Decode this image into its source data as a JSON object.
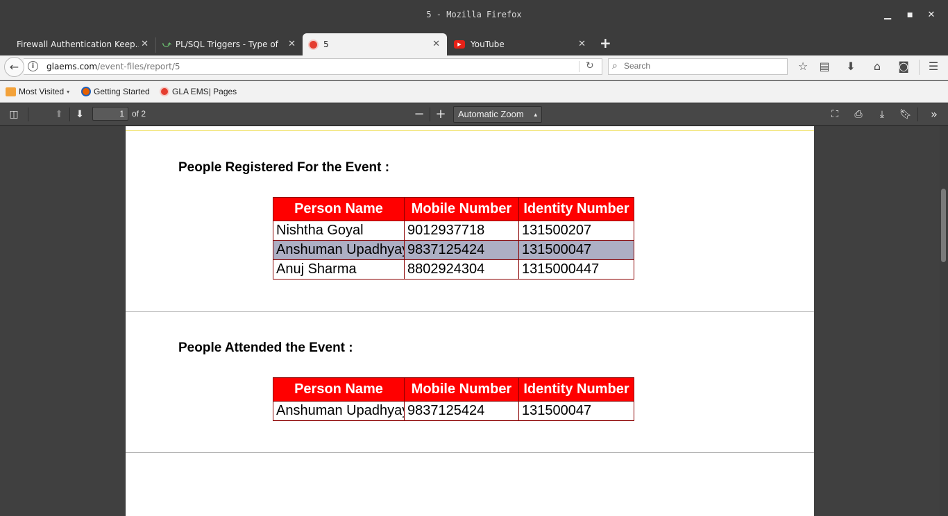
{
  "window": {
    "title": "5 - Mozilla Firefox"
  },
  "tabs": [
    {
      "label": "Firewall Authentication Keep...",
      "icon": "none"
    },
    {
      "label": "PL/SQL Triggers - Type of ...",
      "icon": "tutorials-icon"
    },
    {
      "label": "5",
      "icon": "gla-icon",
      "active": true
    },
    {
      "label": "YouTube",
      "icon": "youtube-icon"
    }
  ],
  "navbar": {
    "url_domain": "glaems.com",
    "url_path": "/event-files/report/5",
    "search_placeholder": "Search"
  },
  "bookmarks": [
    {
      "label": "Most Visited",
      "icon": "folder-icon"
    },
    {
      "label": "Getting Started",
      "icon": "firefox-icon"
    },
    {
      "label": "GLA EMS| Pages",
      "icon": "gla-icon"
    }
  ],
  "pdf_toolbar": {
    "page_number": "1",
    "page_count": "of 2",
    "zoom": "Automatic Zoom"
  },
  "document": {
    "registered": {
      "heading": "People Registered For the Event :",
      "columns": [
        "Person Name",
        "Mobile Number",
        "Identity Number"
      ],
      "rows": [
        [
          "Nishtha Goyal",
          "9012937718",
          "131500207"
        ],
        [
          "Anshuman Upadhyay",
          "9837125424",
          "131500047"
        ],
        [
          "Anuj Sharma",
          "8802924304",
          "1315000447"
        ]
      ]
    },
    "attended": {
      "heading": "People Attended the Event :",
      "columns": [
        "Person Name",
        "Mobile Number",
        "Identity Number"
      ],
      "rows": [
        [
          "Anshuman Upadhyay",
          "9837125424",
          "131500047"
        ]
      ]
    }
  },
  "colors": {
    "table_header_bg": "#ff0000",
    "table_border": "#8b0000",
    "highlight_row": "#adafc4"
  }
}
